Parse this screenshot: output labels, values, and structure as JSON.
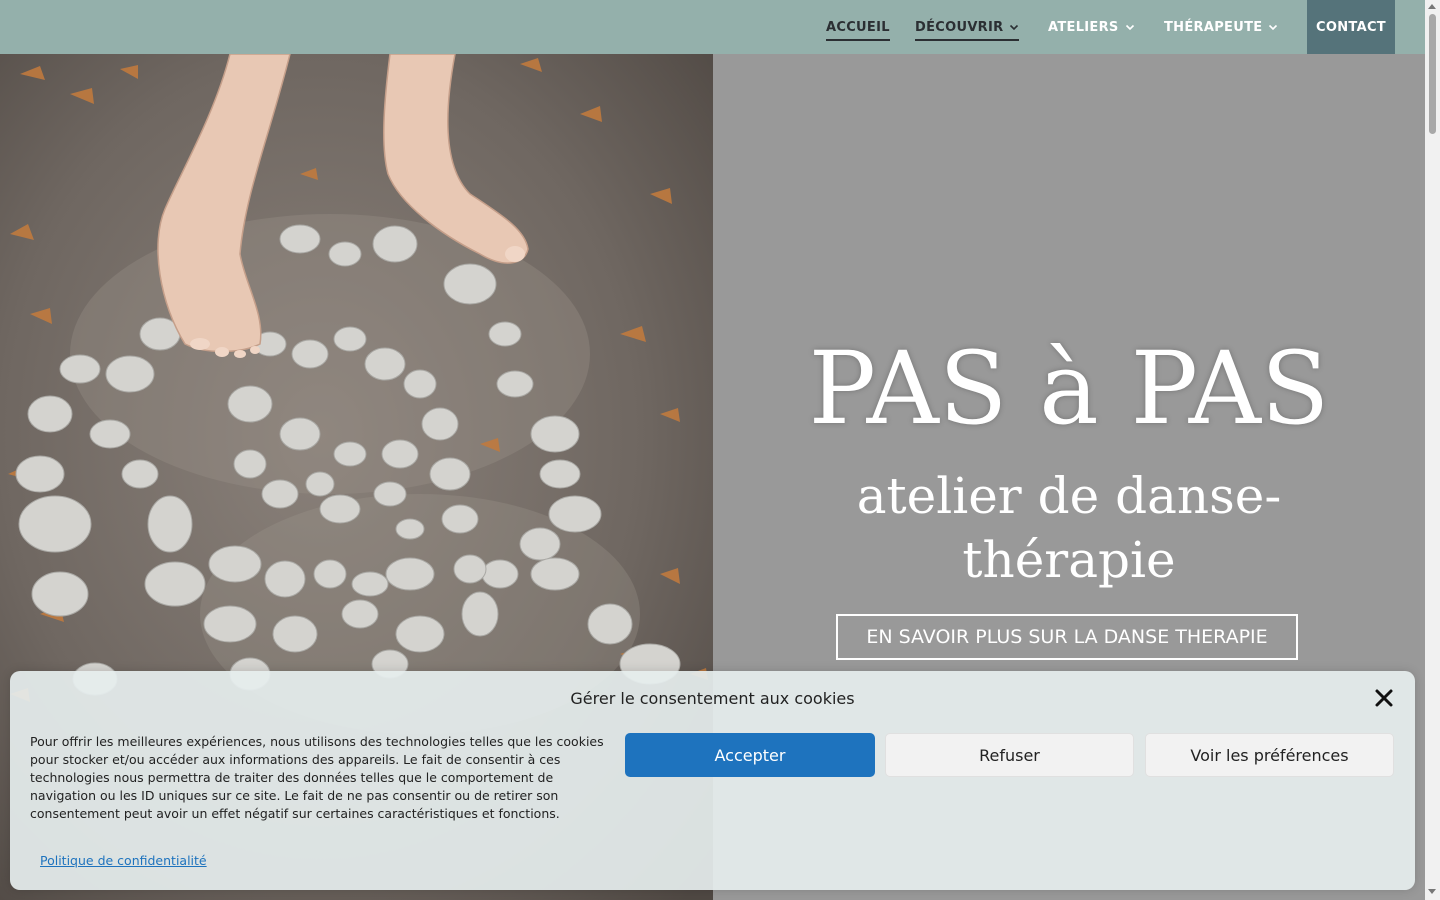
{
  "nav": {
    "items": [
      {
        "label": "ACCUEIL"
      },
      {
        "label": "DÉCOUVRIR"
      },
      {
        "label": "ATELIERS"
      },
      {
        "label": "THÉRAPEUTE"
      }
    ],
    "contact_label": "CONTACT"
  },
  "hero": {
    "title": "PAS à PAS",
    "subtitle": "atelier de danse-thérapie",
    "cta_label": "EN SAVOIR PLUS SUR LA DANSE THERAPIE",
    "image": "bare-feet-stone-spiral-photo"
  },
  "cookie": {
    "title": "Gérer le consentement aux cookies",
    "text": "Pour offrir les meilleures expériences, nous utilisons des technologies telles que les cookies pour stocker et/ou accéder aux informations des appareils. Le fait de consentir à ces technologies nous permettra de traiter des données telles que le comportement de navigation ou les ID uniques sur ce site. Le fait de ne pas consentir ou de retirer son consentement peut avoir un effet négatif sur certaines caractéristiques et fonctions.",
    "accept_label": "Accepter",
    "refuse_label": "Refuser",
    "prefs_label": "Voir les préférences",
    "privacy_link": "Politique de confidentialité"
  },
  "colors": {
    "nav_bg": "#94b0ab",
    "contact_bg": "#55737a",
    "hero_bg": "#999999",
    "accept_bg": "#1e73be"
  }
}
